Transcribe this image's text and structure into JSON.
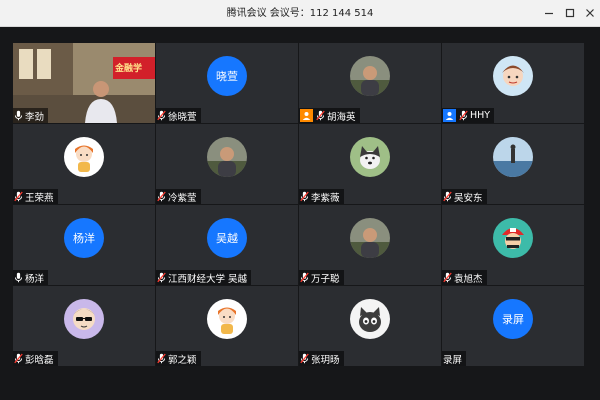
{
  "window": {
    "title": "腾讯会议 会议号：112 144 514",
    "controls": [
      "minimize-icon",
      "maximize-icon",
      "close-icon"
    ]
  },
  "colors": {
    "tile_bg": "#2b2d31",
    "stage_bg": "#161719",
    "avatar_blue": "#1677ff",
    "active_border": "#5bbf6a",
    "host_orange": "#ff8a00"
  },
  "participants": [
    {
      "name": "李劲",
      "video": true,
      "video_sign_text": "金融学",
      "mic": "on"
    },
    {
      "name": "徐晓萱",
      "avatar_text": "晓萱",
      "mic": "muted"
    },
    {
      "name": "胡海英",
      "avatar_icon": "photo-avatar-icon",
      "mic": "muted",
      "badge": "orange"
    },
    {
      "name": "HHY",
      "avatar_icon": "cartoon-avatar-icon",
      "mic": "muted",
      "badge": "blue"
    },
    {
      "name": "王荣燕",
      "avatar_icon": "cartoon-girl-icon",
      "mic": "muted"
    },
    {
      "name": "冷紫莹",
      "avatar_icon": "photo-avatar-icon",
      "mic": "muted"
    },
    {
      "name": "李紫薇",
      "avatar_icon": "husky-dog-icon",
      "mic": "muted"
    },
    {
      "name": "吴安东",
      "avatar_icon": "seaside-photo-icon",
      "mic": "muted"
    },
    {
      "name": "杨洋",
      "avatar_text": "杨洋",
      "mic": "on"
    },
    {
      "name": "江西财经大学 吴越",
      "avatar_text": "吴越",
      "mic": "muted"
    },
    {
      "name": "万子聪",
      "avatar_icon": "photo-avatar-icon",
      "mic": "muted"
    },
    {
      "name": "袁旭杰",
      "avatar_icon": "cartoon-mario-icon",
      "mic": "muted"
    },
    {
      "name": "彭晗磊",
      "avatar_icon": "cartoon-sunglasses-icon",
      "mic": "muted"
    },
    {
      "name": "郭之颖",
      "avatar_icon": "cartoon-girl-icon",
      "mic": "muted"
    },
    {
      "name": "张玥旸",
      "avatar_icon": "cartoon-cat-icon",
      "mic": "muted"
    },
    {
      "name": "录屏",
      "avatar_text": "录屏",
      "mic": "none"
    }
  ]
}
